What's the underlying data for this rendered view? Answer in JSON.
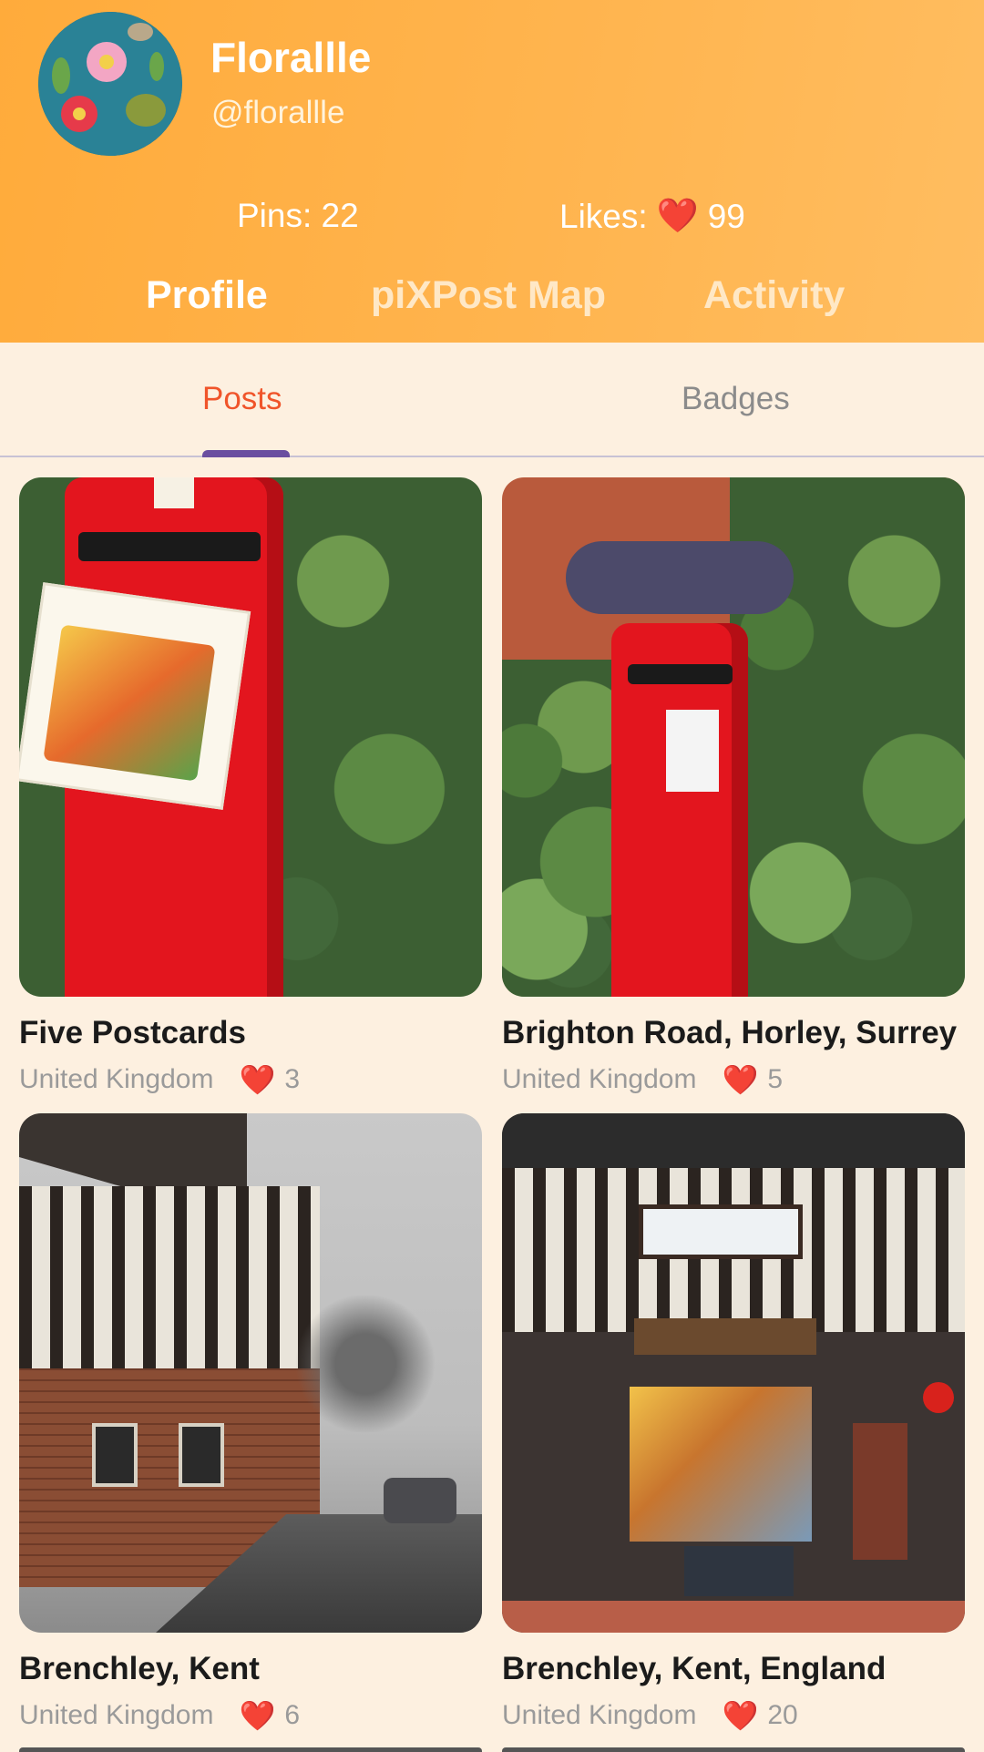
{
  "profile": {
    "display_name": "Florallle",
    "handle": "@florallle",
    "pins_text": "Pins: 22",
    "likes_label": "Likes:",
    "likes_heart": "❤️",
    "likes_count": "99"
  },
  "nav": {
    "items": [
      {
        "label": "Profile",
        "active": true
      },
      {
        "label": "piXPost Map",
        "active": false
      },
      {
        "label": "Activity",
        "active": false
      }
    ]
  },
  "tabs": {
    "items": [
      {
        "label": "Posts",
        "active": true
      },
      {
        "label": "Badges",
        "active": false
      }
    ]
  },
  "posts": [
    {
      "title": "Five Postcards",
      "country": "United Kingdom",
      "heart": "❤️",
      "likes": "3",
      "image": "red-pillar-box-with-postcards-icon"
    },
    {
      "title": "Brighton Road, Horley, Surrey",
      "country": "United Kingdom",
      "heart": "❤️",
      "likes": "5",
      "image": "red-pillar-box-with-knitted-topper-icon"
    },
    {
      "title": "Brenchley, Kent",
      "country": "United Kingdom",
      "heart": "❤️",
      "likes": "6",
      "image": "tudor-street-icon"
    },
    {
      "title": "Brenchley, Kent, England",
      "country": "United Kingdom",
      "heart": "❤️",
      "likes": "20",
      "image": "post-office-shopfront-icon"
    }
  ],
  "colors": {
    "header_start": "#ffab3b",
    "header_end": "#ffbd60",
    "active_tab": "#f0542a",
    "indicator": "#6a4ea0",
    "heart": "#e02424",
    "background": "#fdf0e0"
  }
}
